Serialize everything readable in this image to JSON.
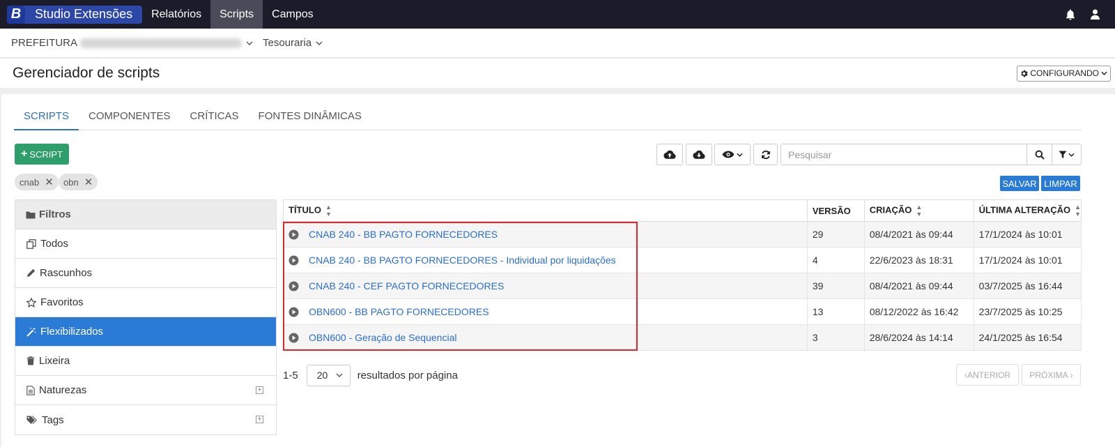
{
  "topbar": {
    "logo_letter": "B",
    "brand_name": "Studio Extensões",
    "nav": [
      "Relatórios",
      "Scripts",
      "Campos"
    ],
    "active_nav": "Scripts",
    "icons": [
      "bell-icon",
      "user-icon"
    ]
  },
  "breadcrumb": {
    "entity_label": "PREFEITURA",
    "module": "Tesouraria"
  },
  "header": {
    "title": "Gerenciador de scripts",
    "config_label": "CONFIGURANDO"
  },
  "tabs": [
    "SCRIPTS",
    "COMPONENTES",
    "CRÍTICAS",
    "FONTES DINÂMICAS"
  ],
  "active_tab": "SCRIPTS",
  "toolbar": {
    "add_script_label": "SCRIPT",
    "search_placeholder": "Pesquisar",
    "save_label": "SALVAR",
    "clear_label": "LIMPAR"
  },
  "chips": [
    "cnab",
    "obn"
  ],
  "sidebar": {
    "title": "Filtros",
    "items": [
      {
        "label": "Todos",
        "icon": "copy-icon"
      },
      {
        "label": "Rascunhos",
        "icon": "pencil-icon"
      },
      {
        "label": "Favoritos",
        "icon": "star-icon"
      },
      {
        "label": "Flexibilizados",
        "icon": "magic-wand-icon",
        "active": true
      },
      {
        "label": "Lixeira",
        "icon": "trash-icon"
      },
      {
        "label": "Naturezas",
        "icon": "document-icon",
        "expandable": true
      },
      {
        "label": "Tags",
        "icon": "tags-icon",
        "expandable": true
      }
    ]
  },
  "table": {
    "columns": [
      "TÍTULO",
      "VERSÃO",
      "CRIAÇÃO",
      "ÚLTIMA ALTERAÇÃO"
    ],
    "rows": [
      {
        "title": "CNAB 240 - BB PAGTO FORNECEDORES",
        "version": "29",
        "created": "08/4/2021 às 09:44",
        "updated": "17/1/2024 às 10:01"
      },
      {
        "title": "CNAB 240 - BB PAGTO FORNECEDORES - Individual por liquidações",
        "version": "4",
        "created": "22/6/2023 às 18:31",
        "updated": "17/1/2024 às 10:01"
      },
      {
        "title": "CNAB 240 - CEF PAGTO FORNECEDORES",
        "version": "39",
        "created": "08/4/2021 às 09:44",
        "updated": "03/7/2025 às 16:44"
      },
      {
        "title": "OBN600 - BB PAGTO FORNECEDORES",
        "version": "13",
        "created": "08/12/2022 às 16:42",
        "updated": "23/7/2025 às 10:25"
      },
      {
        "title": "OBN600 - Geração de Sequencial",
        "version": "3",
        "created": "28/6/2024 às 14:14",
        "updated": "24/1/2025 às 16:54"
      }
    ]
  },
  "pagination": {
    "range": "1-5",
    "per_page": "20",
    "per_page_label": "resultados por página",
    "prev_label": "ANTERIOR",
    "next_label": "PRÓXIMA"
  },
  "colors": {
    "topbar": "#1b1b2a",
    "brand": "#2d47a6",
    "accent": "#2a7bd5",
    "add_button": "#2e9e6a",
    "highlight_box": "#e0262b"
  }
}
